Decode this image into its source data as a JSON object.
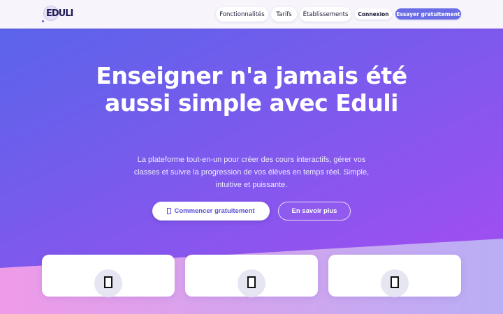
{
  "header": {
    "logo_text": "EDULI",
    "nav": [
      {
        "label": "Fonctionnalités"
      },
      {
        "label": "Tarifs"
      },
      {
        "label": "Établissements"
      },
      {
        "label": "Connexion"
      }
    ],
    "cta_label": "Essayer gratuitement"
  },
  "hero": {
    "title": "Enseigner n'a jamais été aussi simple avec Eduli",
    "subtitle": "La plateforme tout-en-un pour créer des cours interactifs, gérer vos classes et suivre la progression de vos élèves en temps réel. Simple, intuitive et puissante.",
    "primary_button": "Commencer gratuitement",
    "primary_button_icon": "rocket-icon",
    "secondary_button": "En savoir plus"
  },
  "features": {
    "cards": [
      {
        "icon": "document-icon"
      },
      {
        "icon": "document-icon"
      },
      {
        "icon": "document-icon"
      }
    ]
  },
  "colors": {
    "hero_gradient_start": "#5a64ea",
    "hero_gradient_end": "#a24ef0",
    "accent": "#6a6ce6",
    "lower_bg_start": "#ee9be8",
    "lower_bg_end": "#b9aef5"
  }
}
